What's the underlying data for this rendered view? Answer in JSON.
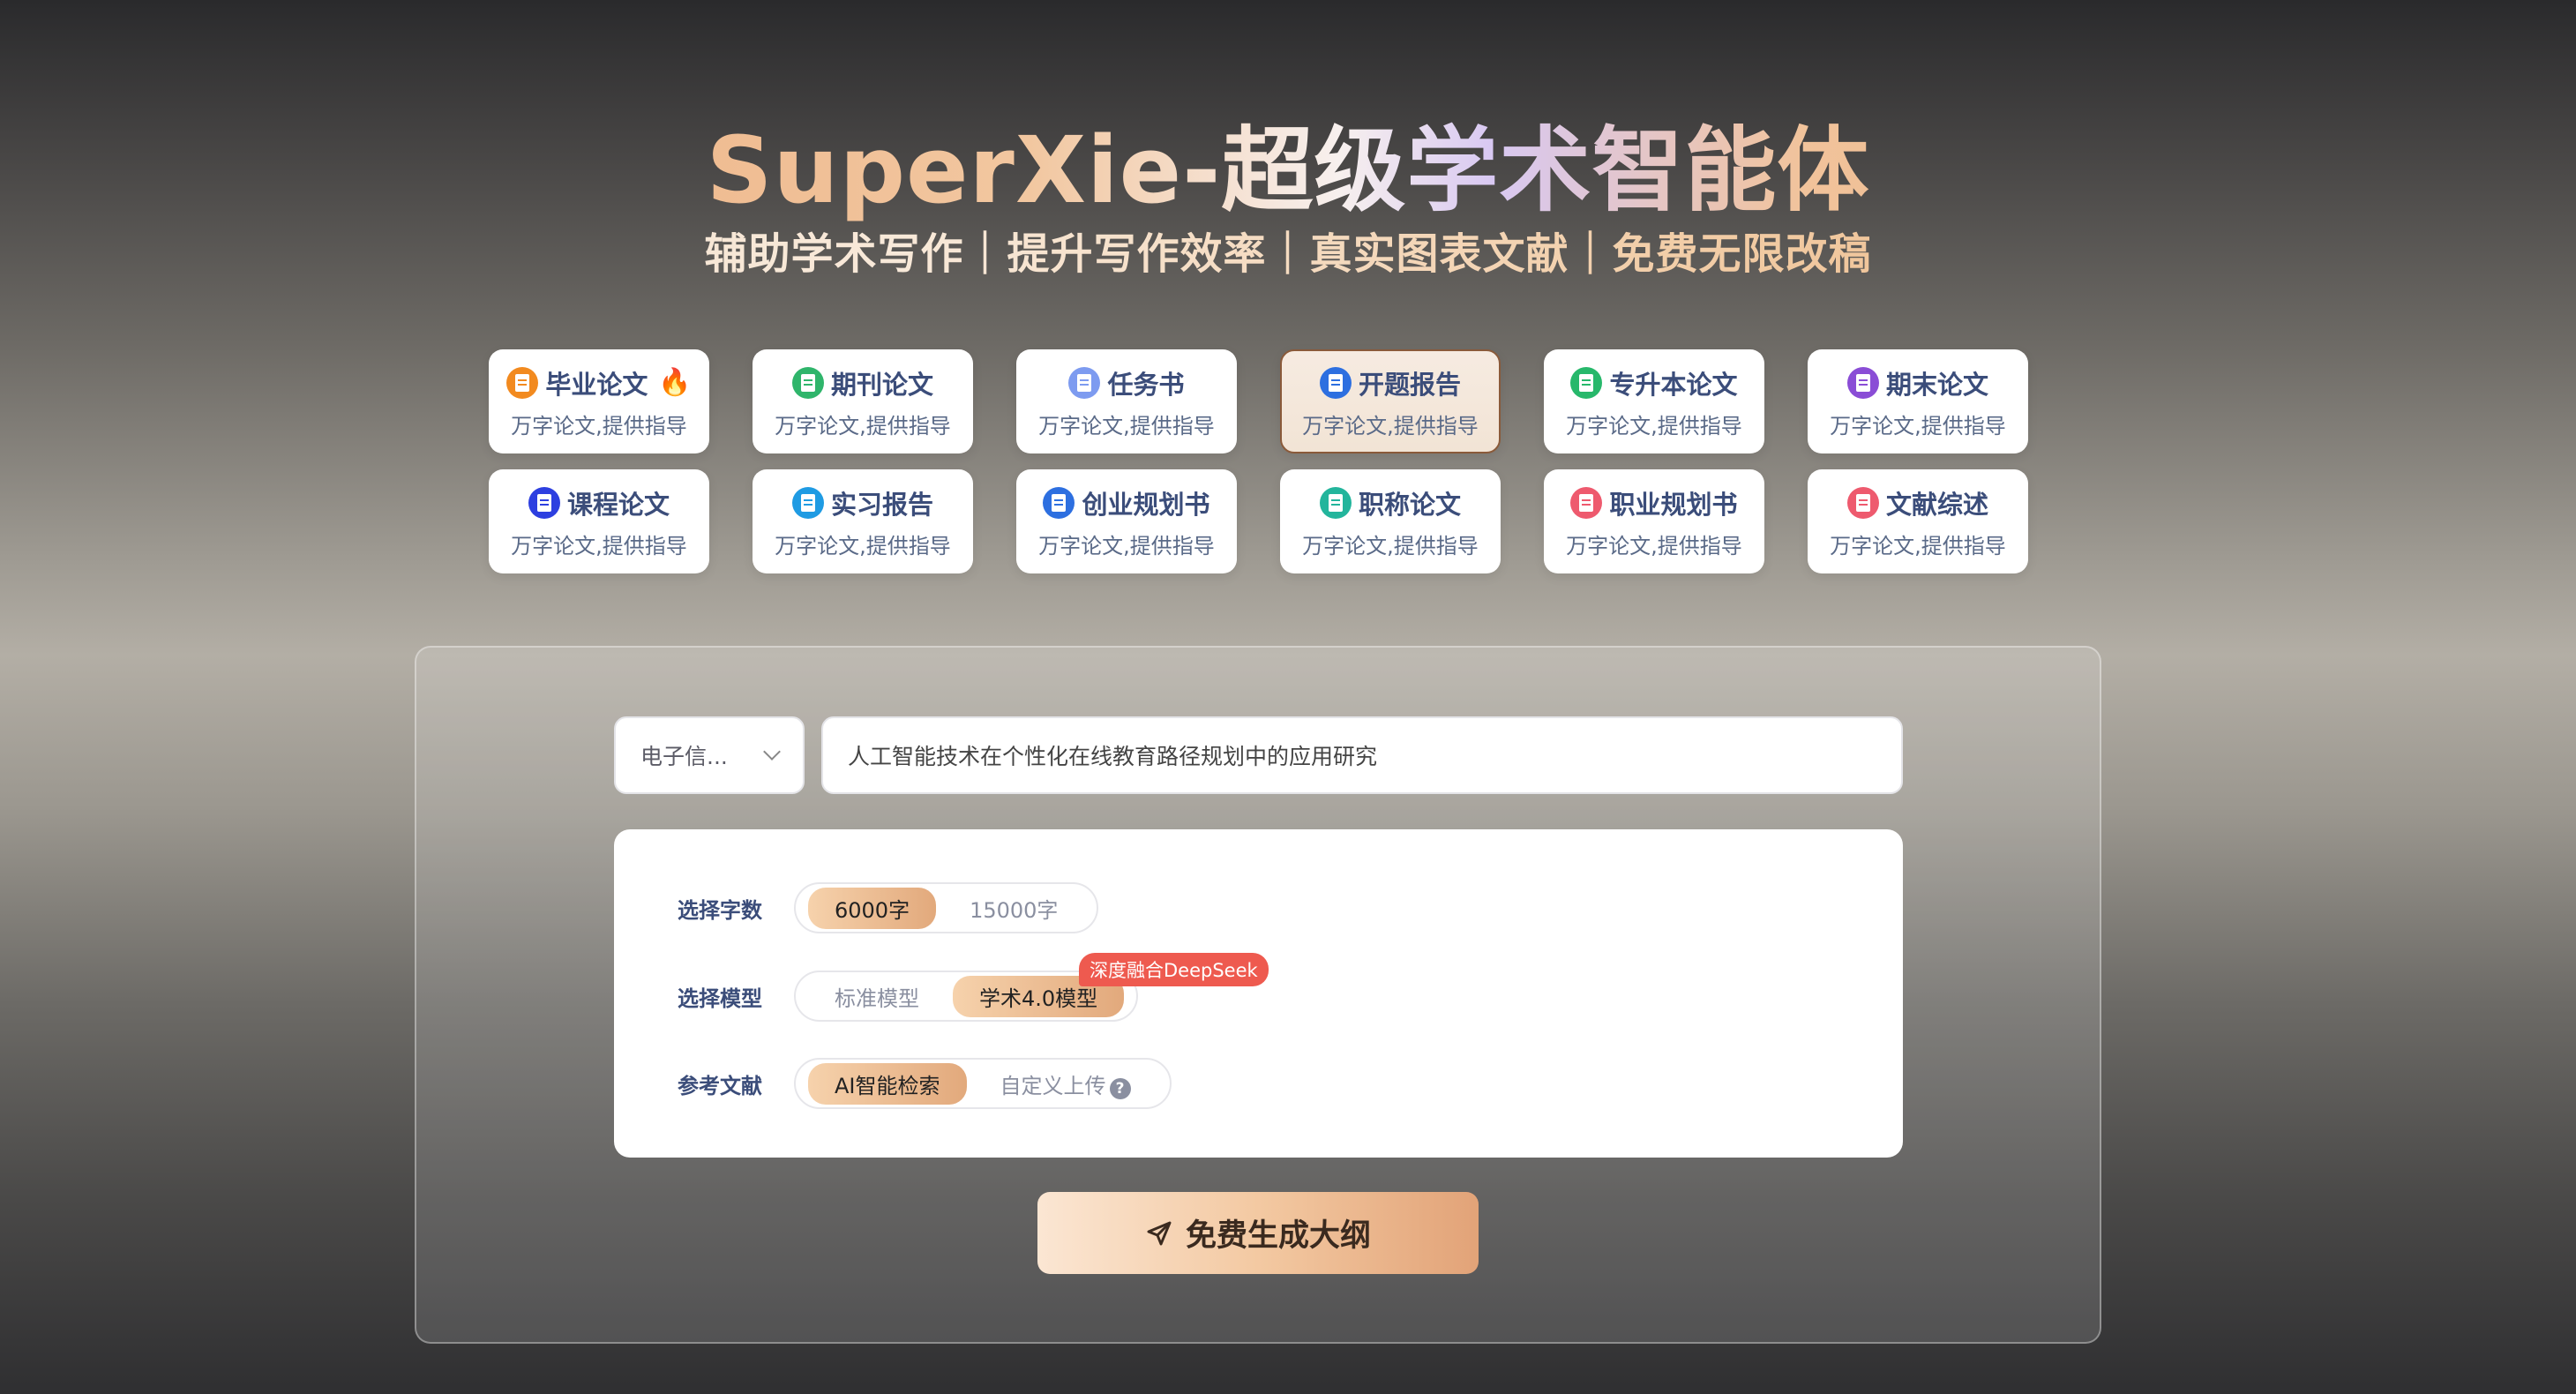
{
  "hero": {
    "title": "SuperXie-超级学术智能体",
    "subtitle": "辅助学术写作｜提升写作效率｜真实图表文献｜免费无限改稿"
  },
  "cards": [
    {
      "title": "毕业论文",
      "sub": "万字论文,提供指导",
      "icon": "doc-icon",
      "color": "#f28a1f",
      "hot": true
    },
    {
      "title": "期刊论文",
      "sub": "万字论文,提供指导",
      "icon": "doc-icon",
      "color": "#2fb56b"
    },
    {
      "title": "任务书",
      "sub": "万字论文,提供指导",
      "icon": "clipboard-icon",
      "color": "#7d9bf0"
    },
    {
      "title": "开题报告",
      "sub": "万字论文,提供指导",
      "icon": "save-icon",
      "color": "#2d6fe0",
      "active": true
    },
    {
      "title": "专升本论文",
      "sub": "万字论文,提供指导",
      "icon": "book-icon",
      "color": "#27b86b"
    },
    {
      "title": "期末论文",
      "sub": "万字论文,提供指导",
      "icon": "doc-icon",
      "color": "#8a4dd6"
    },
    {
      "title": "课程论文",
      "sub": "万字论文,提供指导",
      "icon": "save-icon",
      "color": "#2d3fe0"
    },
    {
      "title": "实习报告",
      "sub": "万字论文,提供指导",
      "icon": "doc-icon",
      "color": "#1f9be3"
    },
    {
      "title": "创业规划书",
      "sub": "万字论文,提供指导",
      "icon": "copy-icon",
      "color": "#2d6fe0"
    },
    {
      "title": "职称论文",
      "sub": "万字论文,提供指导",
      "icon": "doc-icon",
      "color": "#23b59c"
    },
    {
      "title": "职业规划书",
      "sub": "万字论文,提供指导",
      "icon": "list-icon",
      "color": "#ee5a6e"
    },
    {
      "title": "文献综述",
      "sub": "万字论文,提供指导",
      "icon": "list-icon",
      "color": "#ee5a6e"
    }
  ],
  "form": {
    "major": "电子信...",
    "topic": "人工智能技术在个性化在线教育路径规划中的应用研究",
    "word_count": {
      "label": "选择字数",
      "options": [
        "6000字",
        "15000字"
      ],
      "selected": "6000字"
    },
    "model": {
      "label": "选择模型",
      "options": [
        "标准模型",
        "学术4.0模型"
      ],
      "selected": "学术4.0模型",
      "badge": "深度融合DeepSeek"
    },
    "refs": {
      "label": "参考文献",
      "options": [
        "AI智能检索",
        "自定义上传"
      ],
      "selected": "AI智能检索"
    },
    "submit": "免费生成大纲"
  },
  "colors": {
    "accent": "#e2a97c",
    "active_border": "#8a5a3a",
    "badge": "#ee5a4f",
    "card_title": "#3b4d7a"
  }
}
